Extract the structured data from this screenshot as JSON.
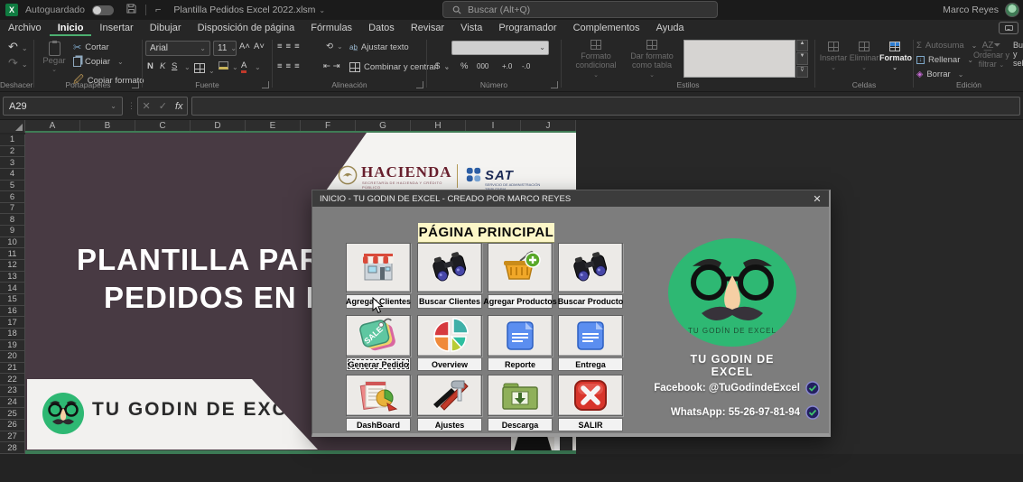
{
  "titlebar": {
    "autosave_label": "Autoguardado",
    "filename": "Plantilla Pedidos Excel 2022.xlsm",
    "search_placeholder": "Buscar (Alt+Q)",
    "user_name": "Marco Reyes"
  },
  "menu": {
    "tabs": [
      {
        "label": "Archivo",
        "active": false
      },
      {
        "label": "Inicio",
        "active": true
      },
      {
        "label": "Insertar",
        "active": false
      },
      {
        "label": "Dibujar",
        "active": false
      },
      {
        "label": "Disposición de página",
        "active": false
      },
      {
        "label": "Fórmulas",
        "active": false
      },
      {
        "label": "Datos",
        "active": false
      },
      {
        "label": "Revisar",
        "active": false
      },
      {
        "label": "Vista",
        "active": false
      },
      {
        "label": "Programador",
        "active": false
      },
      {
        "label": "Complementos",
        "active": false
      },
      {
        "label": "Ayuda",
        "active": false
      }
    ]
  },
  "ribbon": {
    "deshacer": {
      "label": "Deshacer"
    },
    "portapapeles": {
      "label": "Portapapeles",
      "pegar": "Pegar",
      "cortar": "Cortar",
      "copiar": "Copiar",
      "copiar_formato": "Copiar formato"
    },
    "fuente": {
      "label": "Fuente",
      "font_name": "Arial",
      "font_size": "11",
      "bold": "N",
      "italic": "K",
      "underline": "S"
    },
    "alineacion": {
      "label": "Alineación",
      "ajustar_texto": "Ajustar texto",
      "combinar": "Combinar y centrar"
    },
    "numero": {
      "label": "Número",
      "moneda": "$",
      "porcentaje": "%",
      "millares": "000",
      "mas_dec": "+.0",
      "menos_dec": "-.0"
    },
    "estilos": {
      "label": "Estilos",
      "formato_condicional": "Formato condicional",
      "dar_formato": "Dar formato como tabla"
    },
    "celdas": {
      "label": "Celdas",
      "insertar": "Insertar",
      "eliminar": "Eliminar",
      "formato": "Formato"
    },
    "edicion": {
      "label": "Edición",
      "autosuma": "Autosuma",
      "rellenar": "Rellenar",
      "borrar": "Borrar",
      "ordenar_1": "Ordenar y",
      "ordenar_2": "filtrar",
      "buscar": "Buscar y seleccionar"
    }
  },
  "formula_bar": {
    "name_box": "A29",
    "fx": "fx",
    "formula_value": ""
  },
  "sheet": {
    "columns": [
      "A",
      "B",
      "C",
      "D",
      "E",
      "F",
      "G",
      "H",
      "I",
      "J"
    ],
    "row_numbers": [
      1,
      2,
      3,
      4,
      5,
      6,
      7,
      8,
      9,
      10,
      11,
      12,
      13,
      14,
      15,
      16,
      17,
      18,
      19,
      20,
      21,
      22,
      23,
      24,
      25,
      26,
      27,
      28
    ]
  },
  "canvas": {
    "title_line1": "PLANTILLA PAR",
    "title_line2": "PEDIDOS EN E",
    "hacienda": {
      "name": "HACIENDA",
      "caption": "SECRETARÍA DE HACIENDA Y CRÉDITO PÚBLICO"
    },
    "sat": {
      "name": "SAT",
      "caption": "SERVICIO DE ADMINISTRACIÓN TRIBUTARIA"
    },
    "band_brand": "TU GODIN DE EXCEL"
  },
  "dialog": {
    "title": "INICIO - TU GODIN DE EXCEL - CREADO POR MARCO REYES",
    "close_glyph": "✕",
    "heading": "PÁGINA PRINCIPAL",
    "buttons": [
      {
        "label": "Agregar Clientes",
        "icon": "store-icon",
        "focused": false
      },
      {
        "label": "Buscar Clientes",
        "icon": "binoculars-icon",
        "focused": false
      },
      {
        "label": "Agregar Productos",
        "icon": "basket-add-icon",
        "focused": false
      },
      {
        "label": "Buscar Producto",
        "icon": "binoculars-icon",
        "focused": false
      },
      {
        "label": "Generar Pedido",
        "icon": "sale-tag-icon",
        "focused": true,
        "icon_text": "SALE"
      },
      {
        "label": "Overview",
        "icon": "pie-chart-icon",
        "focused": false
      },
      {
        "label": "Reporte",
        "icon": "document-icon",
        "focused": false
      },
      {
        "label": "Entrega",
        "icon": "document-icon",
        "focused": false
      },
      {
        "label": "DashBoard",
        "icon": "report-chart-icon",
        "focused": false
      },
      {
        "label": "Ajustes",
        "icon": "tools-icon",
        "focused": false
      },
      {
        "label": "Descarga",
        "icon": "download-folder-icon",
        "focused": false
      },
      {
        "label": "SALIR",
        "icon": "exit-icon",
        "focused": false
      }
    ],
    "panel": {
      "logo_text": "TU GODÍN DE EXCEL",
      "brand": "TU GODIN DE EXCEL",
      "facebook": "Facebook: @TuGodindeExcel",
      "whatsapp": "WhatsApp: 55-26-97-81-94"
    }
  },
  "colors": {
    "excel_green": "#107c41",
    "accent_green": "#4caf70",
    "sheet_purple": "#483a43",
    "dialog_gray": "#7d7d7d",
    "heading_yellow": "#fdf7c8",
    "avatar_green": "#2eb873",
    "hacienda_maroon": "#69202e",
    "sat_navy": "#1b2a56"
  }
}
